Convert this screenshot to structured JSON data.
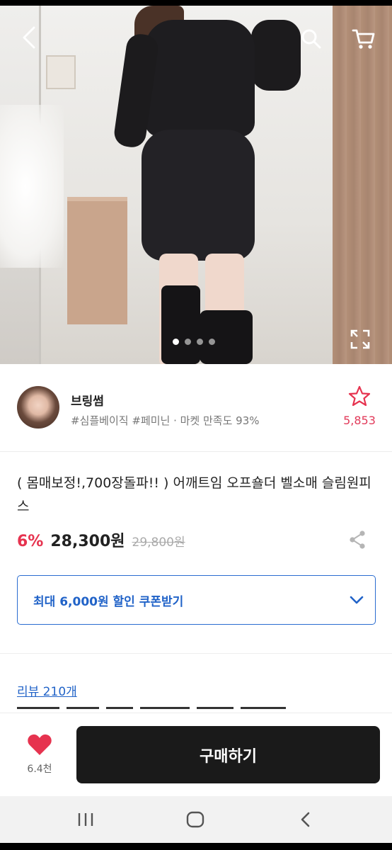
{
  "shop": {
    "name": "브링썸",
    "tags": "#심플베이직 #페미닌 · 마켓 만족도 93%",
    "favorite_count": "5,853"
  },
  "product": {
    "title": "( 몸매보정!,700장돌파!! ) 어깨트임 오프숄더 벨소매 슬림원피스",
    "discount": "6%",
    "price": "28,300원",
    "original_price": "29,800원"
  },
  "coupon": {
    "label": "최대 6,000원 할인 쿠폰받기"
  },
  "reviews": {
    "link_label": "리뷰 210개"
  },
  "gallery": {
    "page_count": 4,
    "current_page": 1
  },
  "action_bar": {
    "like_count": "6.4천",
    "buy_label": "구매하기"
  },
  "icons": {
    "back": "chevron-left-icon",
    "search": "search-icon",
    "cart": "cart-icon",
    "expand": "expand-icon",
    "star": "star-outline-icon",
    "share": "share-icon",
    "heart": "heart-icon"
  },
  "colors": {
    "accent_red": "#e6334f",
    "link_blue": "#2163c8",
    "buy_button": "#1a1a1a"
  }
}
